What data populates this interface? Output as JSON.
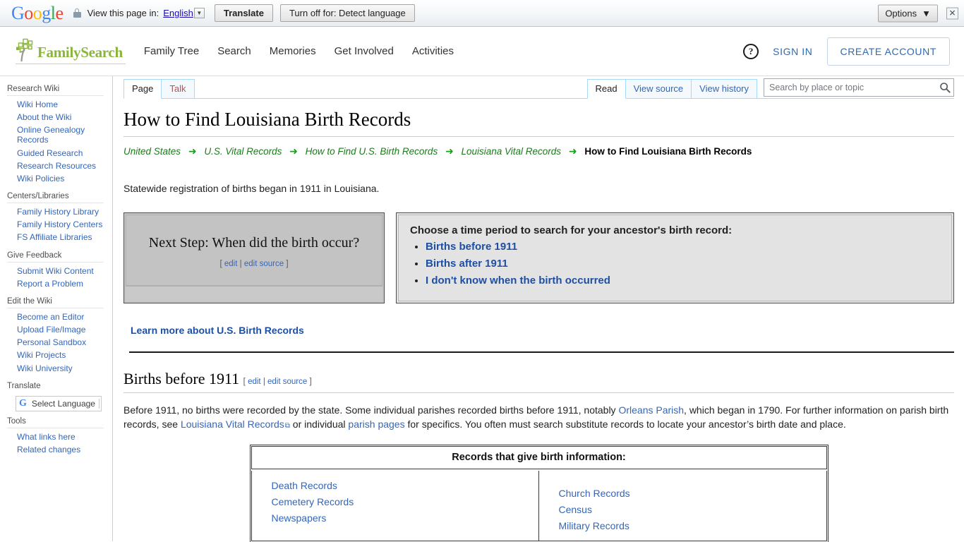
{
  "translate_bar": {
    "logo": "Google",
    "lock_icon": "lock-icon",
    "prompt": "View this page in:",
    "language": "English",
    "translate_label": "Translate",
    "turn_off_label": "Turn off for: Detect language",
    "options_label": "Options",
    "close_icon": "close-icon"
  },
  "header": {
    "brand": "FamilySearch",
    "nav": [
      {
        "label": "Family Tree"
      },
      {
        "label": "Search"
      },
      {
        "label": "Memories"
      },
      {
        "label": "Get Involved"
      },
      {
        "label": "Activities"
      }
    ],
    "help_icon": "help-circle-icon",
    "sign_in": "SIGN IN",
    "create_account": "CREATE ACCOUNT"
  },
  "sidebar": {
    "groups": [
      {
        "title": "Research Wiki",
        "items": [
          "Wiki Home",
          "About the Wiki",
          "Online Genealogy Records",
          "Guided Research",
          "Research Resources",
          "Wiki Policies"
        ]
      },
      {
        "title": "Centers/Libraries",
        "items": [
          "Family History Library",
          "Family History Centers",
          "FS Affiliate Libraries"
        ]
      },
      {
        "title": "Give Feedback",
        "items": [
          "Submit Wiki Content",
          "Report a Problem"
        ]
      },
      {
        "title": "Edit the Wiki",
        "items": [
          "Become an Editor",
          "Upload File/Image",
          "Personal Sandbox",
          "Wiki Projects",
          "Wiki University"
        ]
      }
    ],
    "translate": {
      "title": "Translate",
      "widget_label": "Select Language",
      "widget_icon": "google-g-icon"
    },
    "tools": {
      "title": "Tools",
      "items": [
        "What links here",
        "Related changes"
      ]
    }
  },
  "tabs": {
    "left": [
      {
        "label": "Page",
        "selected": true,
        "newpage": false
      },
      {
        "label": "Talk",
        "selected": false,
        "newpage": true
      }
    ],
    "right": [
      {
        "label": "Read",
        "selected": true
      },
      {
        "label": "View source",
        "selected": false
      },
      {
        "label": "View history",
        "selected": false
      }
    ]
  },
  "search": {
    "placeholder": "Search by place or topic",
    "value": "",
    "icon": "search-icon"
  },
  "article": {
    "title": "How to Find Louisiana Birth Records",
    "breadcrumb": {
      "links": [
        "United States",
        "U.S. Vital Records",
        "How to Find U.S. Birth Records",
        "Louisiana Vital Records"
      ],
      "arrow": "➜",
      "current": "How to Find Louisiana Birth Records"
    },
    "intro": "Statewide registration of births began in 1911 in Louisiana.",
    "next_step": {
      "question": "Next Step: When did the birth occur?",
      "edit_open": "[",
      "edit": "edit",
      "edit_sep": "|",
      "edit_source": "edit source",
      "edit_close": "]",
      "choose_heading": "Choose a time period to search for your ancestor's birth record:",
      "options": [
        "Births before 1911",
        "Births after 1911",
        "I don't know when the birth occurred"
      ]
    },
    "learn_more": "Learn more about U.S. Birth Records",
    "section": {
      "heading": "Births before 1911",
      "edit_open": "[",
      "edit": "edit",
      "edit_sep": "|",
      "edit_source": "edit source",
      "edit_close": "]",
      "paragraph": {
        "p1": "Before 1911, no births were recorded by the state. Some individual parishes recorded births before 1911, notably ",
        "link1": "Orleans Parish",
        "p2": ", which began in 1790. For further information on parish birth records, see ",
        "link2": "Louisiana Vital Records",
        "p3": " or individual ",
        "link3": "parish pages",
        "p4": " for specifics. You often must search substitute records to locate your ancestor’s birth date and place."
      }
    },
    "records_table": {
      "title": "Records that give birth information:",
      "left_column": [
        "Death Records",
        "Cemetery Records",
        "Newspapers"
      ],
      "right_column": [
        "Church Records",
        "Census",
        "Military Records"
      ]
    }
  },
  "colors": {
    "brand_green": "#8bb63c",
    "link_blue": "#3366bb",
    "strong_link_blue": "#1d4fa5",
    "breadcrumb_green": "#1c7a1c",
    "tab_border": "#a7d7f9",
    "box_gray": "#c3c3c3",
    "box_gray_light": "#e3e3e3"
  }
}
